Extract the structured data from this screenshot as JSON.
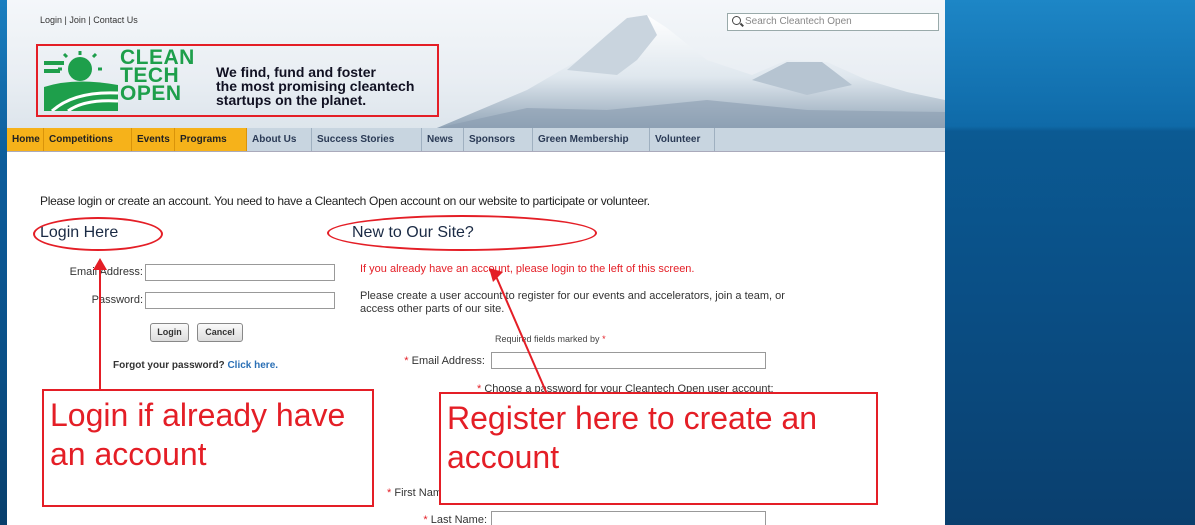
{
  "header": {
    "top_links": "Login | Join | Contact Us",
    "search_placeholder": "Search Cleantech Open",
    "logo_lines": [
      "CLEAN",
      "TECH",
      "OPEN"
    ],
    "tagline": [
      "We find, fund and foster",
      "the most promising cleantech",
      "startups on the planet."
    ]
  },
  "nav": [
    {
      "label": "Home",
      "highlight": true
    },
    {
      "label": "Competitions",
      "highlight": true
    },
    {
      "label": "Events",
      "highlight": true
    },
    {
      "label": "Programs",
      "highlight": true
    },
    {
      "label": "About Us",
      "highlight": false
    },
    {
      "label": "Success Stories",
      "highlight": false
    },
    {
      "label": "News",
      "highlight": false
    },
    {
      "label": "Sponsors",
      "highlight": false
    },
    {
      "label": "Green Membership",
      "highlight": false
    },
    {
      "label": "Volunteer",
      "highlight": false
    }
  ],
  "intro": "Please login or create an account. You need to have a Cleantech Open account on our website to participate or volunteer.",
  "login": {
    "heading": "Login Here",
    "email_label": "Email Address:",
    "password_label": "Password:",
    "login_button": "Login",
    "cancel_button": "Cancel",
    "forgot_text": "Forgot your password?",
    "forgot_link": "Click here."
  },
  "register": {
    "heading": "New to Our Site?",
    "warning": "If you already have an account, please login to the left of this screen.",
    "description": "Please create a user account to register for our events and accelerators, join a team, or access other parts of our site.",
    "required_note": "Required fields marked by",
    "email_label": "Email Address:",
    "password_note": "Choose a password for your Cleantech Open user account:",
    "first_name_label": "First Name:",
    "last_name_label": "Last Name:"
  },
  "callouts": {
    "login": "Login if already have an account",
    "register": "Register here to create an account"
  },
  "colors": {
    "accent_red": "#e41e26",
    "nav_highlight": "#f6b21a",
    "brand_green": "#1e9f4b",
    "link_blue": "#2a6fb5"
  }
}
